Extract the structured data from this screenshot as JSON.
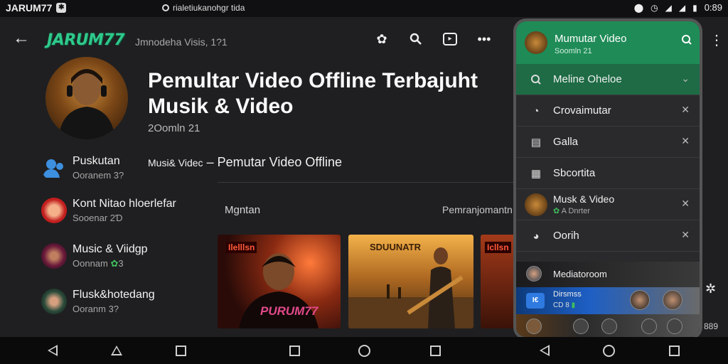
{
  "status_bar": {
    "app_name": "JARUM77",
    "url": "rialetiukanohgr tida",
    "time": "0:89"
  },
  "top_bar": {
    "logo": "JARUM77",
    "subtitle": "Jmnodeha Visis, 1?1"
  },
  "hero": {
    "title": "Pemultar Video Offline Terbajuht Musik & Video",
    "subtitle": "2Oomln 21"
  },
  "breadcrumb": {
    "prefix": "Musi& Videc",
    "separator": "–",
    "title": "Pemutar Video Offline"
  },
  "sections": {
    "left": "Mgntan",
    "right": "Pemranjomantn"
  },
  "list": [
    {
      "name": "Puskutan",
      "meta": "Ooranem 3?"
    },
    {
      "name": "Kont Nitao hloerlefar",
      "meta": "Sooenar 2Ɗ"
    },
    {
      "name": "Music & Viidgp",
      "meta": "Oonnam",
      "badge": "3"
    },
    {
      "name": "Flusk&hotedang",
      "meta": "Ooranm 3?"
    }
  ],
  "thumbnails": [
    {
      "label_top": "Ilelllsn",
      "label_bottom": "PURUM77"
    },
    {
      "label_top": "SDUUNATR"
    },
    {
      "label_top": "Icllsn"
    }
  ],
  "phone": {
    "header_title": "Mumutar Video",
    "header_sub": "Sоomln 21",
    "rows": [
      {
        "label": "Meline Oheloe"
      },
      {
        "label": "Crovaimutar"
      },
      {
        "label": "Galla"
      },
      {
        "label": "Sbcortita"
      },
      {
        "label": "Musk & Video",
        "meta": "A Dnrter"
      },
      {
        "label": "Oorih"
      }
    ],
    "strip_dark": "Mediatoroom",
    "strip_blue_title": "Dirsmss",
    "strip_blue_meta": "CD 8",
    "chip": "I€"
  },
  "side": {
    "number": "889"
  }
}
